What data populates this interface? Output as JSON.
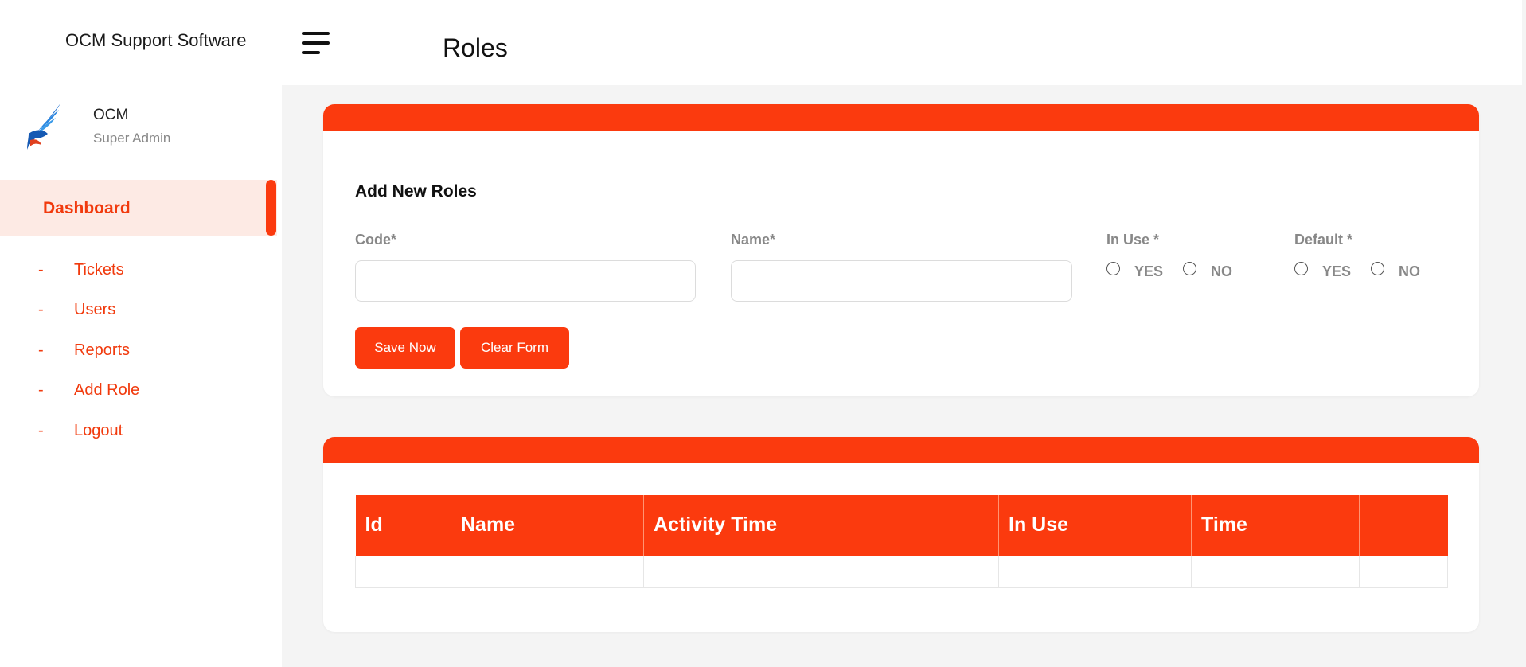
{
  "app": {
    "brand": "OCM Support Software",
    "page_title": "Roles"
  },
  "user": {
    "name": "OCM",
    "role": "Super Admin"
  },
  "sidebar": {
    "dashboard": "Dashboard",
    "items": [
      {
        "label": "Tickets"
      },
      {
        "label": "Users"
      },
      {
        "label": "Reports"
      },
      {
        "label": "Add Role"
      },
      {
        "label": "Logout"
      }
    ]
  },
  "form": {
    "heading": "Add New Roles",
    "code_label": "Code*",
    "name_label": "Name*",
    "in_use_label": "In Use *",
    "default_label": "Default *",
    "yes": "YES",
    "no": "NO",
    "save_button": "Save Now",
    "clear_button": "Clear Form"
  },
  "table": {
    "columns": [
      "Id",
      "Name",
      "Activity Time",
      "In Use",
      "Time",
      ""
    ]
  },
  "colors": {
    "accent": "#fb3a0e",
    "accent_light": "#fdeae4"
  }
}
